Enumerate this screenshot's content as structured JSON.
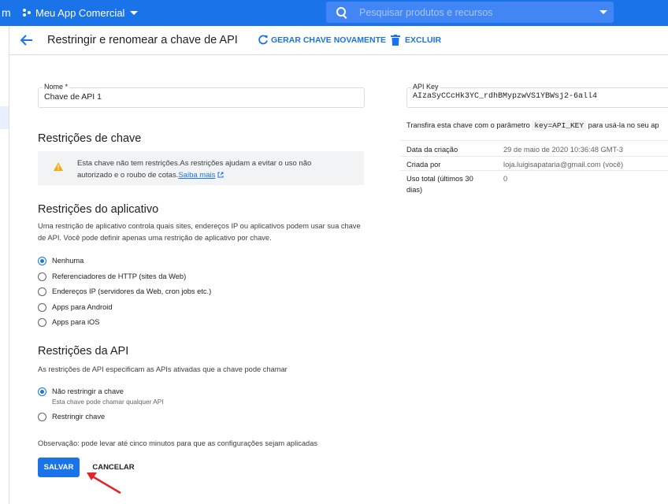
{
  "topbar": {
    "title_fragment": "m",
    "project_name": "Meu App Comercial",
    "search_placeholder": "Pesquisar produtos e recursos"
  },
  "header": {
    "title": "Restringir e renomear a chave de API",
    "regenerate_label": "GERAR CHAVE NOVAMENTE",
    "delete_label": "EXCLUIR"
  },
  "name_field": {
    "label": "Nome *",
    "value": "Chave de API 1"
  },
  "key_restrictions": {
    "heading": "Restrições de chave",
    "warning_text": "Esta chave não tem restrições.As restrições ajudam a evitar o uso não autorizado e o roubo de cotas.",
    "learn_more": "Saiba mais"
  },
  "app_restrictions": {
    "heading": "Restrições do aplicativo",
    "description": "Uma restrição de aplicativo controla quais sites, endereços IP ou aplicativos podem usar sua chave de API. Você pode definir apenas uma restrição de aplicativo por chave.",
    "options": [
      "Nenhuma",
      "Referenciadores de HTTP (sites da Web)",
      "Endereços IP (servidores da Web, cron jobs etc.)",
      "Apps para Android",
      "Apps para iOS"
    ],
    "selected": "Nenhuma"
  },
  "api_restrictions": {
    "heading": "Restrições da API",
    "description": "As restrições de API especificam as APIs ativadas que a chave pode chamar",
    "options": [
      {
        "label": "Não restringir a chave",
        "sub": "Esta chave pode chamar qualquer API"
      },
      {
        "label": "Restringir chave",
        "sub": ""
      }
    ],
    "selected": "Não restringir a chave"
  },
  "note": "Observação: pode levar até cinco minutos para que as configurações sejam aplicadas",
  "actions": {
    "save": "SALVAR",
    "cancel": "CANCELAR"
  },
  "api_key": {
    "label": "API Key",
    "value": "AIzaSyCCcHk3YC_rdhBMypzwVS1YBWsj2-6all4",
    "usage_prefix": "Transfira esta chave com o parâmetro",
    "usage_code": "key=API_KEY",
    "usage_suffix": "para usá-la no seu ap"
  },
  "info": {
    "rows": [
      {
        "key": "Data da criação",
        "value": "29 de maio de 2020 10:36:48 GMT-3"
      },
      {
        "key": "Criada por",
        "value": "loja.luigisapataria@gmail.com (você)"
      },
      {
        "key": "Uso total (últimos 30 dias)",
        "value": "0"
      }
    ]
  },
  "colors": {
    "primary": "#1a73e8",
    "warning": "#f9ab00",
    "annotation_arrow": "#e8202a"
  }
}
